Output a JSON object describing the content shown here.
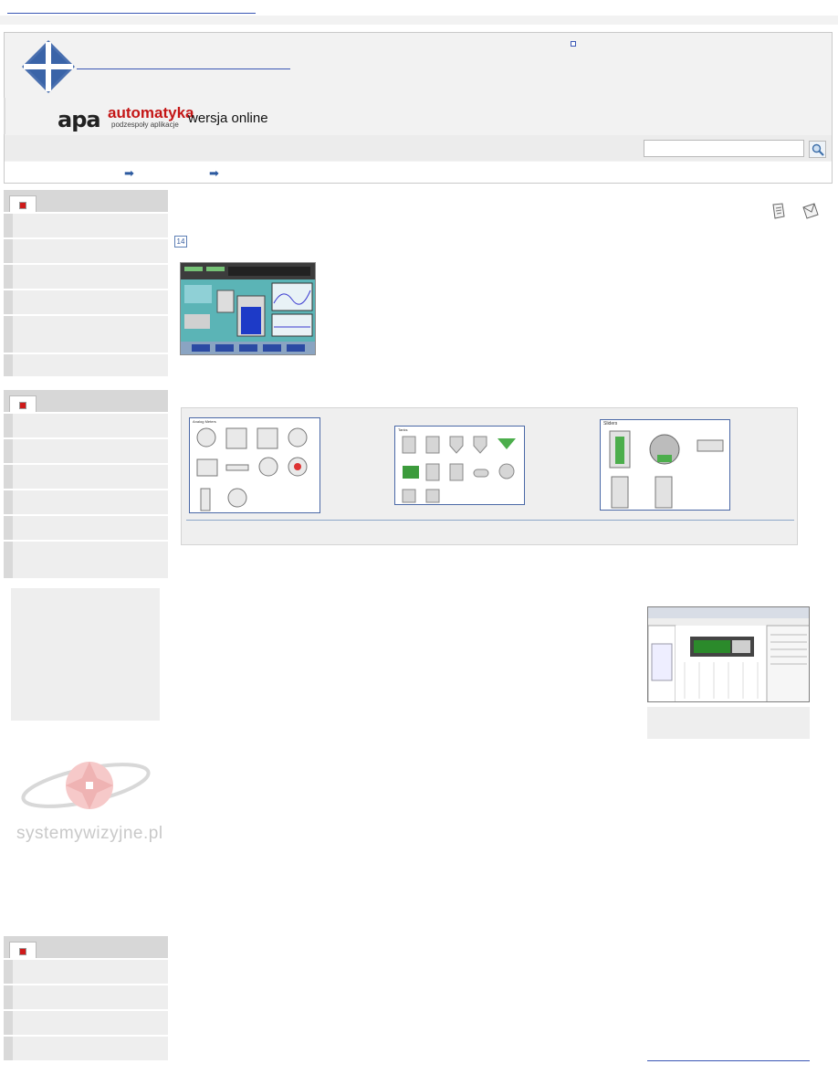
{
  "top": {
    "link_text": ""
  },
  "header": {
    "logo_link_text": "",
    "brand": {
      "mark": "apa",
      "word": "automatyka",
      "subtitle": "podzespoły aplikacje",
      "edition": "wersja online"
    }
  },
  "search": {
    "value": "",
    "placeholder": ""
  },
  "breadcrumbs": {
    "arrow_glyph": "➡"
  },
  "article": {
    "issue_badge": "14",
    "gallery_thumbs": [
      {
        "title": "Analog Meters"
      },
      {
        "title": "Tanks"
      },
      {
        "title": "Sliders"
      }
    ],
    "watermark": "systemywizyjne.pl"
  },
  "sidebar": {
    "block1": {
      "items": [
        "",
        "",
        "",
        "",
        "",
        ""
      ]
    },
    "block2": {
      "items": [
        "",
        "",
        "",
        "",
        "",
        ""
      ]
    },
    "block3": {
      "items": [
        "",
        "",
        "",
        ""
      ]
    }
  },
  "colors": {
    "accent_blue": "#2c5aa0",
    "brand_red": "#c41616",
    "link_blue": "#3a57b5"
  },
  "icons": {
    "print": "print-icon",
    "email": "email-icon",
    "search": "search-icon"
  }
}
